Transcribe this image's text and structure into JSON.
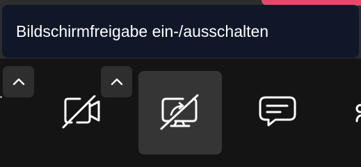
{
  "tooltip": {
    "text": "Bildschirmfreigabe ein-/ausschalten"
  },
  "colors": {
    "background": "#141414",
    "tooltip_background": "#0f1729",
    "accent": "#e8496b",
    "active_button": "#353535",
    "chevron_button": "#2e2e2e"
  },
  "toolbar": {
    "buttons": [
      {
        "name": "camera-toggle",
        "icon": "video-off-icon",
        "state": "off"
      },
      {
        "name": "screen-share-toggle",
        "icon": "screen-share-off-icon",
        "state": "off",
        "active": true
      },
      {
        "name": "chat",
        "icon": "chat-bubble-icon"
      },
      {
        "name": "reactions",
        "icon": "partially-visible-icon"
      }
    ],
    "chevrons": [
      {
        "icon": "chevron-up-icon"
      },
      {
        "icon": "chevron-up-icon"
      }
    ]
  }
}
